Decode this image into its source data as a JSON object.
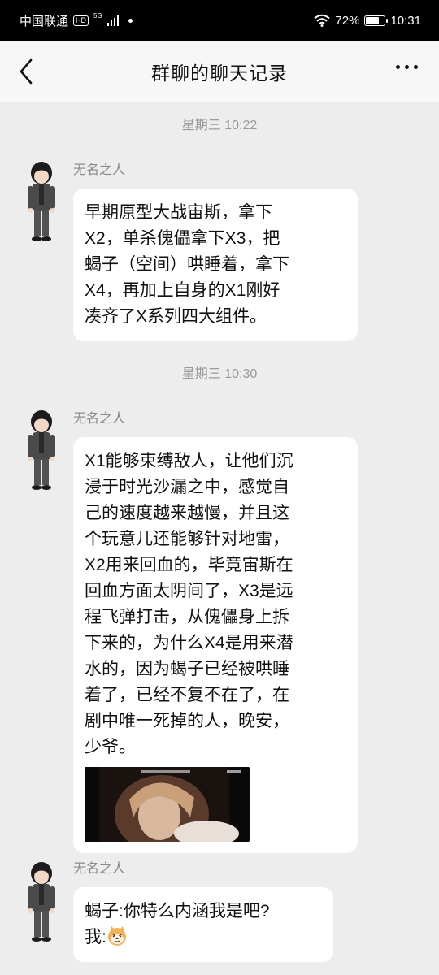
{
  "status_bar": {
    "carrier": "中国联通",
    "hd": "HD",
    "network": "5G",
    "battery": "72%",
    "battery_level": 0.72,
    "time": "10:31"
  },
  "nav": {
    "title": "群聊的聊天记录",
    "back_icon": "chevron-left-icon",
    "more_icon": "more-dots-icon"
  },
  "messages": [
    {
      "timestamp": "星期三 10:22",
      "sender": "无名之人",
      "lines": [
        "早期原型大战宙斯，拿下",
        "X2，单杀傀儡拿下X3，把",
        "蝎子（空间）哄睡着，拿下",
        "X4，再加上自身的X1刚好",
        "凑齐了X系列四大组件。"
      ]
    },
    {
      "timestamp": "星期三 10:30",
      "sender": "无名之人",
      "lines": [
        "X1能够束缚敌人，让他们沉",
        "浸于时光沙漏之中，感觉自",
        "己的速度越来越慢，并且这",
        "个玩意儿还能够针对地雷，",
        "X2用来回血的，毕竟宙斯在",
        "回血方面太阴间了，X3是远",
        "程飞弹打击，从傀儡身上拆",
        "下来的，为什么X4是用来潜",
        "水的，因为蝎子已经被哄睡",
        "着了，已经不复不在了，在",
        "剧中唯一死掉的人，晚安，",
        "少爷。"
      ],
      "has_image": true
    },
    {
      "sender": "无名之人",
      "lines": [
        "蝎子:你特么内涵我是吧?",
        "我:"
      ],
      "emoji": "shiba-dog-emoji"
    }
  ]
}
